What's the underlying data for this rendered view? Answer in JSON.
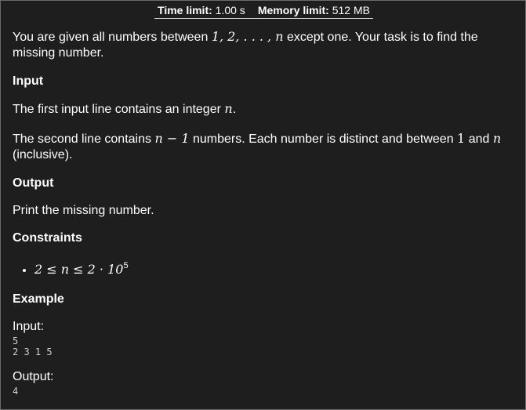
{
  "header": {
    "time_label": "Time limit:",
    "time_value": "1.00 s",
    "memory_label": "Memory limit:",
    "memory_value": "512 MB"
  },
  "statement": {
    "intro_pre": "You are given all numbers between",
    "intro_math": "1, 2, . . . , n",
    "intro_post": "except one. Your task is to find the missing number."
  },
  "input_section": {
    "heading": "Input",
    "line1_pre": "The first input line contains an integer",
    "line1_math": "n",
    "line1_post": ".",
    "line2_pre": "The second line contains",
    "line2_math": "n − 1",
    "line2_mid": "numbers. Each number is distinct and between",
    "line2_math_a": "1",
    "line2_and": "and",
    "line2_math_b": "n",
    "line2_post": "(inclusive)."
  },
  "output_section": {
    "heading": "Output",
    "text": "Print the missing number."
  },
  "constraints": {
    "heading": "Constraints",
    "item_math": "2 ≤ n ≤ 2 · 10",
    "item_exponent": "5"
  },
  "example": {
    "heading": "Example",
    "input_label": "Input:",
    "input_lines": [
      "5",
      "2 3 1 5"
    ],
    "output_label": "Output:",
    "output_lines": [
      "4"
    ]
  }
}
